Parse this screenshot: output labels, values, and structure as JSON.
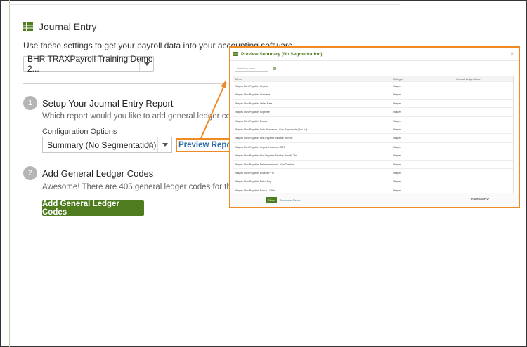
{
  "header": {
    "title": "Journal Entry",
    "icon": "table-icon"
  },
  "intro": "Use these settings to get your payroll data into your accounting software.",
  "company_select": {
    "value": "BHR TRAXPayroll Training Demo 2..."
  },
  "step1": {
    "number": "1",
    "title": "Setup Your Journal Entry Report",
    "subtitle": "Which report would you like to add general ledger codes to?",
    "config_label": "Configuration Options",
    "config_value": "Summary (No Segmentation)",
    "preview_link": "Preview Report"
  },
  "step2": {
    "number": "2",
    "title": "Add General Ledger Codes",
    "subtitle": "Awesome! There are 405 general ledger codes for this report.",
    "button": "Add General Ledger Codes"
  },
  "preview_dialog": {
    "title": "Preview Summary (No Segmentation)",
    "close": "×",
    "search_placeholder": "Search by name...",
    "columns": [
      "Memo",
      "Category",
      "General Ledger Code"
    ],
    "rows": [
      [
        "Wages Non-Payable: Regular",
        "Wages",
        ""
      ],
      [
        "Wages Non-Payable: Overtime",
        "Wages",
        ""
      ],
      [
        "Wages Non-Payable: Other Rate",
        "Wages",
        ""
      ],
      [
        "Wages Non-Payable: Expense",
        "Wages",
        ""
      ],
      [
        "Wages Non-Payable: Bonus",
        "Wages",
        ""
      ],
      [
        "Wages Non-Payable: Auto Allowance - Non Reportable (Box 14)",
        "Wages",
        ""
      ],
      [
        "Wages Non-Payable: Non Payable Taxable Income",
        "Wages",
        ""
      ],
      [
        "Wages Non-Payable: Imputed Income - GTL",
        "Wages",
        ""
      ],
      [
        "Wages Non-Payable: Non Payable Taxable Benefit 2%",
        "Wages",
        ""
      ],
      [
        "Wages Non-Payable: Reimbursement - Non Taxable",
        "Wages",
        ""
      ],
      [
        "Wages Non-Payable: Excess PTO",
        "Wages",
        ""
      ],
      [
        "Wages Non-Payable: Retro Pay",
        "Wages",
        ""
      ],
      [
        "Wages Non-Payable: Bonus - Other",
        "Wages",
        ""
      ]
    ],
    "close_button": "Close",
    "download_link": "Download Report",
    "logo": "bambooHR"
  },
  "colors": {
    "accent": "#4f7c1f",
    "highlight": "#f08a24",
    "link": "#2c6da8"
  }
}
